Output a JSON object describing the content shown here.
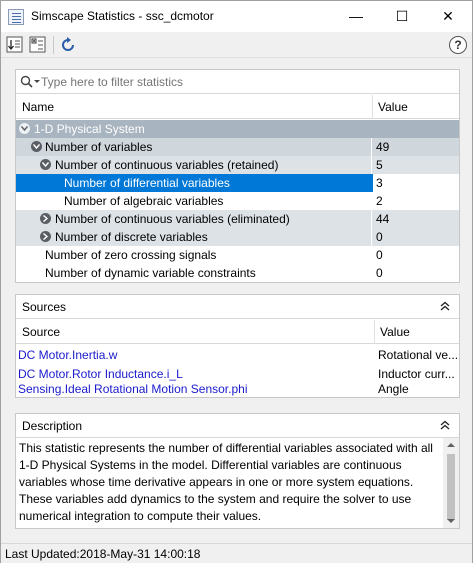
{
  "window": {
    "title": "Simscape Statistics - ssc_dcmotor",
    "minimize_glyph": "—",
    "maximize_glyph": "☐",
    "close_glyph": "✕"
  },
  "toolbar": {
    "help_label": "?"
  },
  "statistics": {
    "filter_placeholder": "Type here to filter statistics",
    "col_name": "Name",
    "col_value": "Value",
    "rows": [
      {
        "name": "1-D Physical System",
        "value": ""
      },
      {
        "name": "Number of variables",
        "value": "49"
      },
      {
        "name": "Number of continuous variables (retained)",
        "value": "5"
      },
      {
        "name": "Number of differential variables",
        "value": "3"
      },
      {
        "name": "Number of algebraic variables",
        "value": "2"
      },
      {
        "name": "Number of continuous variables (eliminated)",
        "value": "44"
      },
      {
        "name": "Number of discrete variables",
        "value": "0"
      },
      {
        "name": "Number of zero crossing signals",
        "value": "0"
      },
      {
        "name": "Number of dynamic variable constraints",
        "value": "0"
      }
    ]
  },
  "sources": {
    "title": "Sources",
    "col_source": "Source",
    "col_value": "Value",
    "rows": [
      {
        "source": "DC Motor.Inertia.w",
        "value": "Rotational ve..."
      },
      {
        "source": "DC Motor.Rotor Inductance.i_L",
        "value": "Inductor curr..."
      },
      {
        "source": "Sensing.Ideal Rotational Motion Sensor.phi",
        "value": "Angle"
      }
    ]
  },
  "description": {
    "title": "Description",
    "text": "This statistic represents the number of differential variables associated with all 1-D Physical Systems in the model. Differential variables are continuous variables whose time derivative appears in one or more system equations. These variables add dynamics to the system and require the solver to use numerical integration to compute their values."
  },
  "status": {
    "last_updated": "Last Updated:2018-May-31 14:00:18"
  },
  "colors": {
    "selection": "#0078d7",
    "group_level1": "#a8b4bf",
    "group_level2": "#cfd6dc",
    "link": "#1a1acc"
  }
}
